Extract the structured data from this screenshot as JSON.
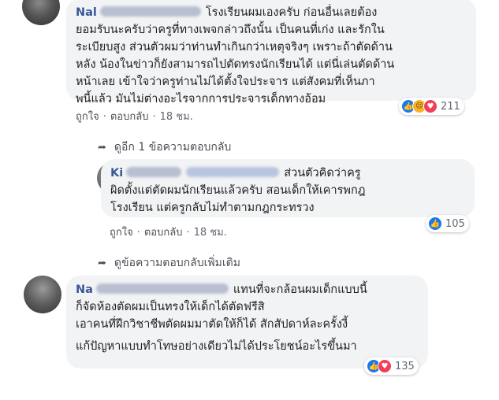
{
  "comments": [
    {
      "author": "Nal",
      "text_lines": [
        "โรงเรียนผมเองครับ ก่อนอื่นเลยต้อง",
        "ยอมรับนะครับว่าครูที่ทางเพจกล่าวถึงนั้น เป็นคนที่เก่ง และรักใน",
        "ระเบียบสูง ส่วนตัวผมว่าท่านทำเกินกว่าเหตุจริงๆ เพราะถ้าตัดด้าน",
        "หลัง น้องในข่าวก็ยังสามารถไปตัดทรงนักเรียนได้ แต่นี่เล่นตัดด้าน",
        "หน้าเลย เข้าใจว่าครูท่านไม่ได้ตั้งใจประจาร แต่สังคมที่เห็นภา",
        "พนี้แล้ว มันไม่ต่างอะไรจากการประจารเด็กทางอ้อม"
      ],
      "reaction_count": "211",
      "reactions": [
        "like-icon",
        "haha-icon",
        "love-icon"
      ],
      "like_label": "ถูกใจ",
      "reply_label": "ตอบกลับ",
      "time": "18 ชม."
    },
    {
      "author": "Ki",
      "text_lines": [
        "ส่วนตัวคิดว่าครู",
        "ผิดตั้งแต่ตัดผมนักเรียนแล้วครับ สอนเด็กให้เคารพกฎ",
        "โรงเรียน แต่ครูกลับไม่ทำตามกฎกระทรวง"
      ],
      "reaction_count": "105",
      "reactions": [
        "like-icon"
      ],
      "like_label": "ถูกใจ",
      "reply_label": "ตอบกลับ",
      "time": "18 ชม."
    },
    {
      "author": "Na",
      "text_lines": [
        "แทนที่จะกล้อนผมเด็กแบบนี้",
        "ก็จัดห้องตัดผมเป็นทรงให้เด็กได้ตัดฟรีสิ",
        "เอาคนที่ฝึกวิชาชีพตัดผมมาตัดให้ก็ได้ สักสัปดาห์ละครั้งงี้",
        "แก้ปัญหาแบบทำโทษอย่างเดียวไม่ได้ประโยชน์อะไรขึ้นมา"
      ],
      "reaction_count": "135",
      "reactions": [
        "like-icon",
        "love-icon"
      ]
    }
  ],
  "view_more_replies": "ดูอีก 1 ข้อความตอบกลับ",
  "view_more_comments": "ดูข้อความตอบกลับเพิ่มเติม",
  "colors": {
    "link": "#385898",
    "bubble": "#f2f3f5",
    "like": "#1877f2",
    "love": "#f33e58"
  }
}
